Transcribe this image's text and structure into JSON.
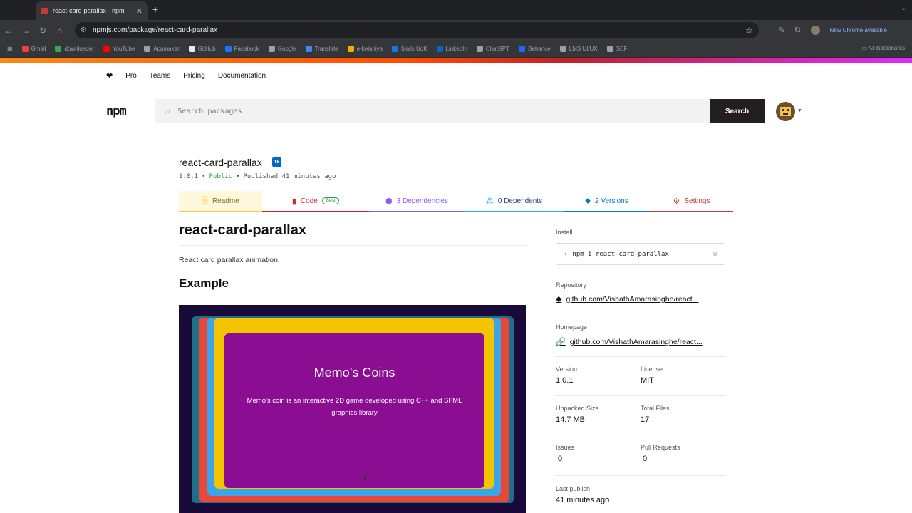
{
  "browser": {
    "tab_title": "react-card-parallax - npm",
    "url": "npmjs.com/package/react-card-parallax",
    "new_chrome": "New Chrome available",
    "bookmarks": [
      {
        "label": "Gmail",
        "color": "#ea4335"
      },
      {
        "label": "downloader",
        "color": "#34a853"
      },
      {
        "label": "YouTube",
        "color": "#ff0000"
      },
      {
        "label": "Appmaker",
        "color": "#9aa0a6"
      },
      {
        "label": "GitHub",
        "color": "#e8eaed"
      },
      {
        "label": "Facebook",
        "color": "#1877f2"
      },
      {
        "label": "Google",
        "color": "#9aa0a6"
      },
      {
        "label": "Translate",
        "color": "#4285f4"
      },
      {
        "label": "e-kelaniya",
        "color": "#f9ab00"
      },
      {
        "label": "Mails UoK",
        "color": "#1a73e8"
      },
      {
        "label": "LinkedIn",
        "color": "#0a66c2"
      },
      {
        "label": "ChatGPT",
        "color": "#9aa0a6"
      },
      {
        "label": "Behance",
        "color": "#1769ff"
      },
      {
        "label": "LMS UI/UX",
        "color": "#9aa0a6"
      },
      {
        "label": "SEF",
        "color": "#9aa0a6"
      }
    ],
    "all_bookmarks": "All Bookmarks"
  },
  "npm_nav": {
    "items": [
      "Pro",
      "Teams",
      "Pricing",
      "Documentation"
    ]
  },
  "search": {
    "placeholder": "Search packages",
    "button": "Search"
  },
  "package": {
    "name": "react-card-parallax",
    "ts_badge": "TS",
    "version": "1.0.1",
    "bullet": "•",
    "visibility": "Public",
    "published": "Published 41 minutes ago"
  },
  "tabs": [
    {
      "label": "Readme",
      "icon": "document-icon",
      "color": "#ffcd3a",
      "bg": "#fff8dc",
      "text": "#856e1e"
    },
    {
      "label": "Code",
      "icon": "code-icon",
      "color": "#c7262f",
      "bg": "#ffffff",
      "text": "#c7262f",
      "badge": "Beta"
    },
    {
      "label": "3 Dependencies",
      "icon": "box-icon",
      "color": "#8956ff",
      "bg": "#ffffff",
      "text": "#8956ff"
    },
    {
      "label": "0 Dependents",
      "icon": "boxes-icon",
      "color": "#29abe2",
      "bg": "#ffffff",
      "text": "#2a3a8f"
    },
    {
      "label": "2 Versions",
      "icon": "tag-icon",
      "color": "#0077c7",
      "bg": "#ffffff",
      "text": "#0077c7"
    },
    {
      "label": "Settings",
      "icon": "gear-icon",
      "color": "#cb3837",
      "bg": "#ffffff",
      "text": "#cb3837"
    }
  ],
  "readme": {
    "title": "react-card-parallax",
    "description": "React card parallax animation.",
    "example_heading": "Example",
    "card_title": "Memo’s Coins",
    "card_desc": "Memo's coin is an interactive 2D game developed using C++ and SFML graphics library"
  },
  "sidebar": {
    "install_label": "Install",
    "install_cmd": "npm i react-card-parallax",
    "repository_label": "Repository",
    "repository": "github.com/VishathAmarasinghe/react...",
    "homepage_label": "Homepage",
    "homepage": "github.com/VishathAmarasinghe/react...",
    "version_label": "Version",
    "version": "1.0.1",
    "license_label": "License",
    "license": "MIT",
    "unpacked_label": "Unpacked Size",
    "unpacked": "14.7 MB",
    "files_label": "Total Files",
    "files": "17",
    "issues_label": "Issues",
    "issues": "0",
    "prs_label": "Pull Requests",
    "prs": "0",
    "last_publish_label": "Last publish",
    "last_publish": "41 minutes ago"
  }
}
